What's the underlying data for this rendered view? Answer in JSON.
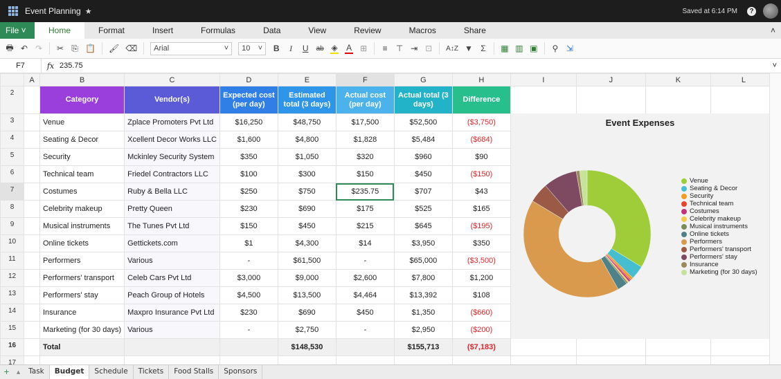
{
  "app": {
    "title": "Event Planning",
    "saved": "Saved at 6:14 PM",
    "help": "?"
  },
  "menu": {
    "file": "File",
    "items": [
      "Home",
      "Format",
      "Insert",
      "Formulas",
      "Data",
      "View",
      "Review",
      "Macros",
      "Share"
    ]
  },
  "toolbar": {
    "font": "Arial",
    "size": "10",
    "bold": "B",
    "italic": "I",
    "underline": "U",
    "strike": "ab",
    "sigma": "Σ"
  },
  "formula": {
    "cell": "F7",
    "fx": "fx",
    "value": "235.75"
  },
  "columns": [
    "A",
    "B",
    "C",
    "D",
    "E",
    "F",
    "G",
    "H",
    "I",
    "J",
    "K",
    "L"
  ],
  "headers": [
    {
      "label": "Category",
      "color": "#9a3fdc"
    },
    {
      "label": "Vendor(s)",
      "color": "#5b5bd8"
    },
    {
      "label": "Expected cost (per day)",
      "color": "#2f7fe6"
    },
    {
      "label": "Estimated total (3 days)",
      "color": "#2f95e8"
    },
    {
      "label": "Actual cost (per day)",
      "color": "#4cb2ec"
    },
    {
      "label": "Actual total (3 days)",
      "color": "#23b3c8"
    },
    {
      "label": "Difference",
      "color": "#27c08d"
    }
  ],
  "rows": [
    {
      "n": "3",
      "cat": "Venue",
      "vendor": "Zplace Promoters Pvt Ltd",
      "exp": "$16,250",
      "est": "$48,750",
      "act": "$17,500",
      "tot": "$52,500",
      "diff": "($3,750)",
      "neg": true
    },
    {
      "n": "4",
      "cat": "Seating & Decor",
      "vendor": "Xcellent Decor Works LLC",
      "exp": "$1,600",
      "est": "$4,800",
      "act": "$1,828",
      "tot": "$5,484",
      "diff": "($684)",
      "neg": true
    },
    {
      "n": "5",
      "cat": "Security",
      "vendor": "Mckinley Security System",
      "exp": "$350",
      "est": "$1,050",
      "act": "$320",
      "tot": "$960",
      "diff": "$90",
      "neg": false
    },
    {
      "n": "6",
      "cat": "Technical team",
      "vendor": "Friedel Contractors LLC",
      "exp": "$100",
      "est": "$300",
      "act": "$150",
      "tot": "$450",
      "diff": "($150)",
      "neg": true
    },
    {
      "n": "7",
      "cat": "Costumes",
      "vendor": "Ruby & Bella LLC",
      "exp": "$250",
      "est": "$750",
      "act": "$235.75",
      "tot": "$707",
      "diff": "$43",
      "neg": false
    },
    {
      "n": "8",
      "cat": "Celebrity makeup",
      "vendor": "Pretty Queen",
      "exp": "$230",
      "est": "$690",
      "act": "$175",
      "tot": "$525",
      "diff": "$165",
      "neg": false
    },
    {
      "n": "9",
      "cat": "Musical instruments",
      "vendor": "The Tunes Pvt Ltd",
      "exp": "$150",
      "est": "$450",
      "act": "$215",
      "tot": "$645",
      "diff": "($195)",
      "neg": true
    },
    {
      "n": "10",
      "cat": "Online tickets",
      "vendor": "Gettickets.com",
      "exp": "$1",
      "est": "$4,300",
      "act": "$14",
      "tot": "$3,950",
      "diff": "$350",
      "neg": false
    },
    {
      "n": "11",
      "cat": "Performers",
      "vendor": "Various",
      "exp": "-",
      "est": "$61,500",
      "act": "-",
      "tot": "$65,000",
      "diff": "($3,500)",
      "neg": true
    },
    {
      "n": "12",
      "cat": "Performers' transport",
      "vendor": "Celeb Cars Pvt Ltd",
      "exp": "$3,000",
      "est": "$9,000",
      "act": "$2,600",
      "tot": "$7,800",
      "diff": "$1,200",
      "neg": false
    },
    {
      "n": "13",
      "cat": "Performers' stay",
      "vendor": "Peach Group of Hotels",
      "exp": "$4,500",
      "est": "$13,500",
      "act": "$4,464",
      "tot": "$13,392",
      "diff": "$108",
      "neg": false
    },
    {
      "n": "14",
      "cat": "Insurance",
      "vendor": "Maxpro Insurance Pvt Ltd",
      "exp": "$230",
      "est": "$690",
      "act": "$450",
      "tot": "$1,350",
      "diff": "($660)",
      "neg": true
    },
    {
      "n": "15",
      "cat": "Marketing (for 30 days)",
      "vendor": "Various",
      "exp": "-",
      "est": "$2,750",
      "act": "-",
      "tot": "$2,950",
      "diff": "($200)",
      "neg": true
    }
  ],
  "total": {
    "n": "16",
    "label": "Total",
    "est": "$148,530",
    "tot": "$155,713",
    "diff": "($7,183)"
  },
  "tabs": [
    "Task",
    "Budget",
    "Schedule",
    "Tickets",
    "Food Stalls",
    "Sponsors"
  ],
  "active_tab": "Budget",
  "chart_data": {
    "type": "pie",
    "variant": "donut",
    "title": "Event Expenses",
    "legend": "right",
    "categories": [
      "Venue",
      "Seating & Decor",
      "Security",
      "Technical team",
      "Costumes",
      "Celebrity makeup",
      "Musical instruments",
      "Online tickets",
      "Performers",
      "Performers' transport",
      "Performers' stay",
      "Insurance",
      "Marketing (for 30 days)"
    ],
    "values": [
      52500,
      5484,
      960,
      450,
      707,
      525,
      645,
      3950,
      65000,
      7800,
      13392,
      1350,
      2950
    ],
    "colors": [
      "#9fcd3a",
      "#45bfd0",
      "#f39c1f",
      "#e8452c",
      "#c2317a",
      "#f5c84c",
      "#7d8b5a",
      "#4f8188",
      "#d99a4e",
      "#9a5a45",
      "#7e4a62",
      "#9c8a5a",
      "#c7e39a"
    ]
  }
}
